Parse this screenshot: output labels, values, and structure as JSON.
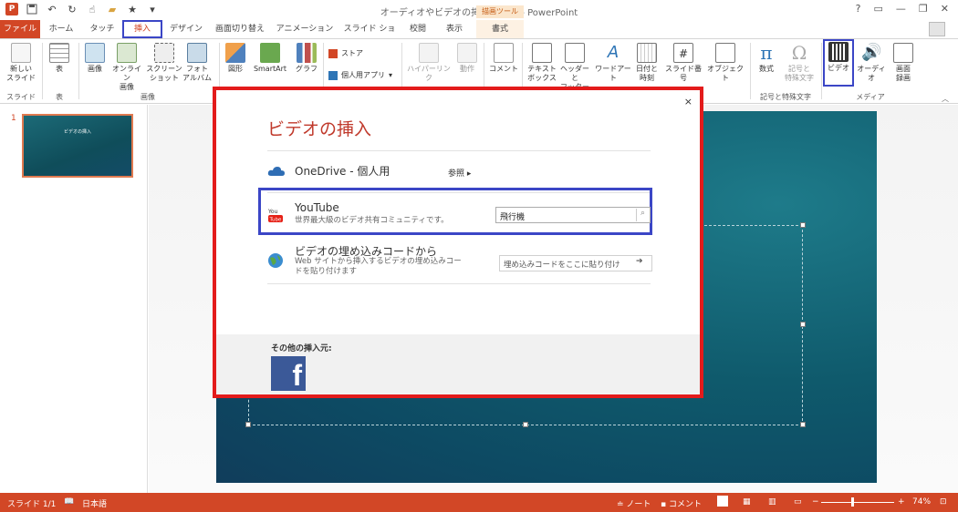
{
  "window": {
    "title": "オーディオやビデオの挿入5.pptx - PowerPoint",
    "controls": [
      "?",
      "▭",
      "—",
      "❐",
      "✕"
    ]
  },
  "tabs": {
    "file": "ファイル",
    "items": [
      "ホーム",
      "タッチ",
      "挿入",
      "デザイン",
      "画面切り替え",
      "アニメーション",
      "スライド ショー",
      "校閲",
      "表示"
    ],
    "context_group": "描画ツール",
    "context_tab": "書式"
  },
  "ribbon": {
    "slides": {
      "new_slide": "新しい\nスライド",
      "group": "スライド"
    },
    "tables": {
      "table": "表",
      "group": "表"
    },
    "images": {
      "picture": "画像",
      "online_pictures": "オンライン\n画像",
      "screenshot": "スクリーン\nショット",
      "photo_album": "フォト\nアルバム",
      "group": "画像"
    },
    "illustrations": {
      "shapes": "図形",
      "smartart": "SmartArt",
      "chart": "グラフ"
    },
    "apps": {
      "store": "ストア",
      "my_apps": "個人用アプリ"
    },
    "links": {
      "hyperlink": "ハイパーリンク",
      "action": "動作"
    },
    "comments": {
      "comment": "コメント"
    },
    "text": {
      "textbox": "テキスト\nボックス",
      "header_footer": "ヘッダーと\nフッター",
      "wordart": "ワードアート",
      "date_time": "日付と\n時刻",
      "slide_number": "スライド番号",
      "object": "オブジェクト"
    },
    "symbols": {
      "equation": "数式",
      "symbol": "記号と\n特殊文字",
      "group": "記号と特殊文字"
    },
    "media": {
      "video": "ビデオ",
      "audio": "オーディオ",
      "screen_recording": "画面\n録画",
      "group": "メディア"
    }
  },
  "thumbnails": {
    "slide_number": "1",
    "thumb_title": "ビデオの挿入"
  },
  "dialog": {
    "title": "ビデオの挿入",
    "close": "×",
    "onedrive": {
      "name": "OneDrive - 個人用",
      "browse": "参照 ▸"
    },
    "youtube": {
      "name": "YouTube",
      "desc": "世界最大級のビデオ共有コミュニティです。",
      "search_value": "飛行機"
    },
    "embed": {
      "name": "ビデオの埋め込みコードから",
      "desc": "Web サイトから挿入するビデオの埋め込みコードを貼り付けます",
      "placeholder": "埋め込みコードをここに貼り付け"
    },
    "other_sources": "その他の挿入元:",
    "facebook": "f"
  },
  "statusbar": {
    "slide": "スライド 1/1",
    "language": "日本語",
    "notes": "ノート",
    "comments": "コメント",
    "zoom": "74%"
  }
}
